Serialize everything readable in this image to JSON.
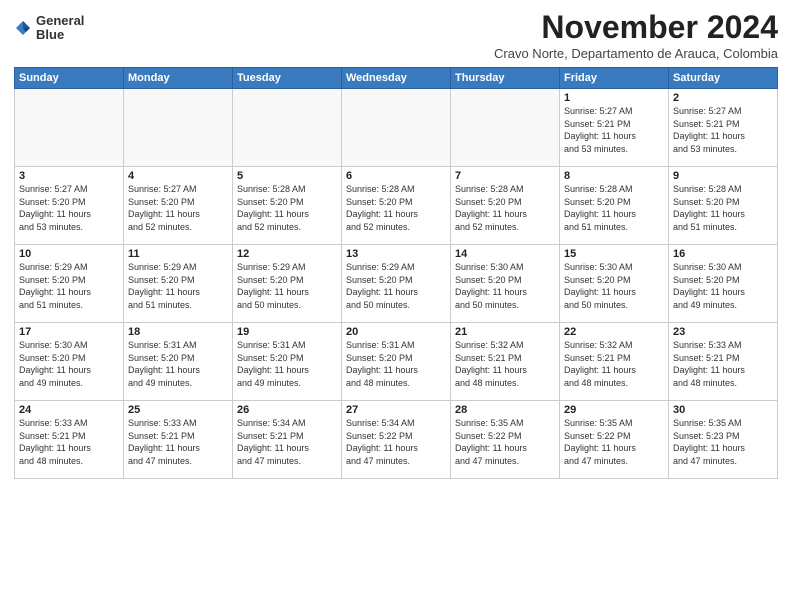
{
  "logo": {
    "line1": "General",
    "line2": "Blue"
  },
  "title": "November 2024",
  "subtitle": "Cravo Norte, Departamento de Arauca, Colombia",
  "calendar": {
    "headers": [
      "Sunday",
      "Monday",
      "Tuesday",
      "Wednesday",
      "Thursday",
      "Friday",
      "Saturday"
    ],
    "weeks": [
      [
        {
          "day": "",
          "info": ""
        },
        {
          "day": "",
          "info": ""
        },
        {
          "day": "",
          "info": ""
        },
        {
          "day": "",
          "info": ""
        },
        {
          "day": "",
          "info": ""
        },
        {
          "day": "1",
          "info": "Sunrise: 5:27 AM\nSunset: 5:21 PM\nDaylight: 11 hours\nand 53 minutes."
        },
        {
          "day": "2",
          "info": "Sunrise: 5:27 AM\nSunset: 5:21 PM\nDaylight: 11 hours\nand 53 minutes."
        }
      ],
      [
        {
          "day": "3",
          "info": "Sunrise: 5:27 AM\nSunset: 5:20 PM\nDaylight: 11 hours\nand 53 minutes."
        },
        {
          "day": "4",
          "info": "Sunrise: 5:27 AM\nSunset: 5:20 PM\nDaylight: 11 hours\nand 52 minutes."
        },
        {
          "day": "5",
          "info": "Sunrise: 5:28 AM\nSunset: 5:20 PM\nDaylight: 11 hours\nand 52 minutes."
        },
        {
          "day": "6",
          "info": "Sunrise: 5:28 AM\nSunset: 5:20 PM\nDaylight: 11 hours\nand 52 minutes."
        },
        {
          "day": "7",
          "info": "Sunrise: 5:28 AM\nSunset: 5:20 PM\nDaylight: 11 hours\nand 52 minutes."
        },
        {
          "day": "8",
          "info": "Sunrise: 5:28 AM\nSunset: 5:20 PM\nDaylight: 11 hours\nand 51 minutes."
        },
        {
          "day": "9",
          "info": "Sunrise: 5:28 AM\nSunset: 5:20 PM\nDaylight: 11 hours\nand 51 minutes."
        }
      ],
      [
        {
          "day": "10",
          "info": "Sunrise: 5:29 AM\nSunset: 5:20 PM\nDaylight: 11 hours\nand 51 minutes."
        },
        {
          "day": "11",
          "info": "Sunrise: 5:29 AM\nSunset: 5:20 PM\nDaylight: 11 hours\nand 51 minutes."
        },
        {
          "day": "12",
          "info": "Sunrise: 5:29 AM\nSunset: 5:20 PM\nDaylight: 11 hours\nand 50 minutes."
        },
        {
          "day": "13",
          "info": "Sunrise: 5:29 AM\nSunset: 5:20 PM\nDaylight: 11 hours\nand 50 minutes."
        },
        {
          "day": "14",
          "info": "Sunrise: 5:30 AM\nSunset: 5:20 PM\nDaylight: 11 hours\nand 50 minutes."
        },
        {
          "day": "15",
          "info": "Sunrise: 5:30 AM\nSunset: 5:20 PM\nDaylight: 11 hours\nand 50 minutes."
        },
        {
          "day": "16",
          "info": "Sunrise: 5:30 AM\nSunset: 5:20 PM\nDaylight: 11 hours\nand 49 minutes."
        }
      ],
      [
        {
          "day": "17",
          "info": "Sunrise: 5:30 AM\nSunset: 5:20 PM\nDaylight: 11 hours\nand 49 minutes."
        },
        {
          "day": "18",
          "info": "Sunrise: 5:31 AM\nSunset: 5:20 PM\nDaylight: 11 hours\nand 49 minutes."
        },
        {
          "day": "19",
          "info": "Sunrise: 5:31 AM\nSunset: 5:20 PM\nDaylight: 11 hours\nand 49 minutes."
        },
        {
          "day": "20",
          "info": "Sunrise: 5:31 AM\nSunset: 5:20 PM\nDaylight: 11 hours\nand 48 minutes."
        },
        {
          "day": "21",
          "info": "Sunrise: 5:32 AM\nSunset: 5:21 PM\nDaylight: 11 hours\nand 48 minutes."
        },
        {
          "day": "22",
          "info": "Sunrise: 5:32 AM\nSunset: 5:21 PM\nDaylight: 11 hours\nand 48 minutes."
        },
        {
          "day": "23",
          "info": "Sunrise: 5:33 AM\nSunset: 5:21 PM\nDaylight: 11 hours\nand 48 minutes."
        }
      ],
      [
        {
          "day": "24",
          "info": "Sunrise: 5:33 AM\nSunset: 5:21 PM\nDaylight: 11 hours\nand 48 minutes."
        },
        {
          "day": "25",
          "info": "Sunrise: 5:33 AM\nSunset: 5:21 PM\nDaylight: 11 hours\nand 47 minutes."
        },
        {
          "day": "26",
          "info": "Sunrise: 5:34 AM\nSunset: 5:21 PM\nDaylight: 11 hours\nand 47 minutes."
        },
        {
          "day": "27",
          "info": "Sunrise: 5:34 AM\nSunset: 5:22 PM\nDaylight: 11 hours\nand 47 minutes."
        },
        {
          "day": "28",
          "info": "Sunrise: 5:35 AM\nSunset: 5:22 PM\nDaylight: 11 hours\nand 47 minutes."
        },
        {
          "day": "29",
          "info": "Sunrise: 5:35 AM\nSunset: 5:22 PM\nDaylight: 11 hours\nand 47 minutes."
        },
        {
          "day": "30",
          "info": "Sunrise: 5:35 AM\nSunset: 5:23 PM\nDaylight: 11 hours\nand 47 minutes."
        }
      ]
    ]
  }
}
